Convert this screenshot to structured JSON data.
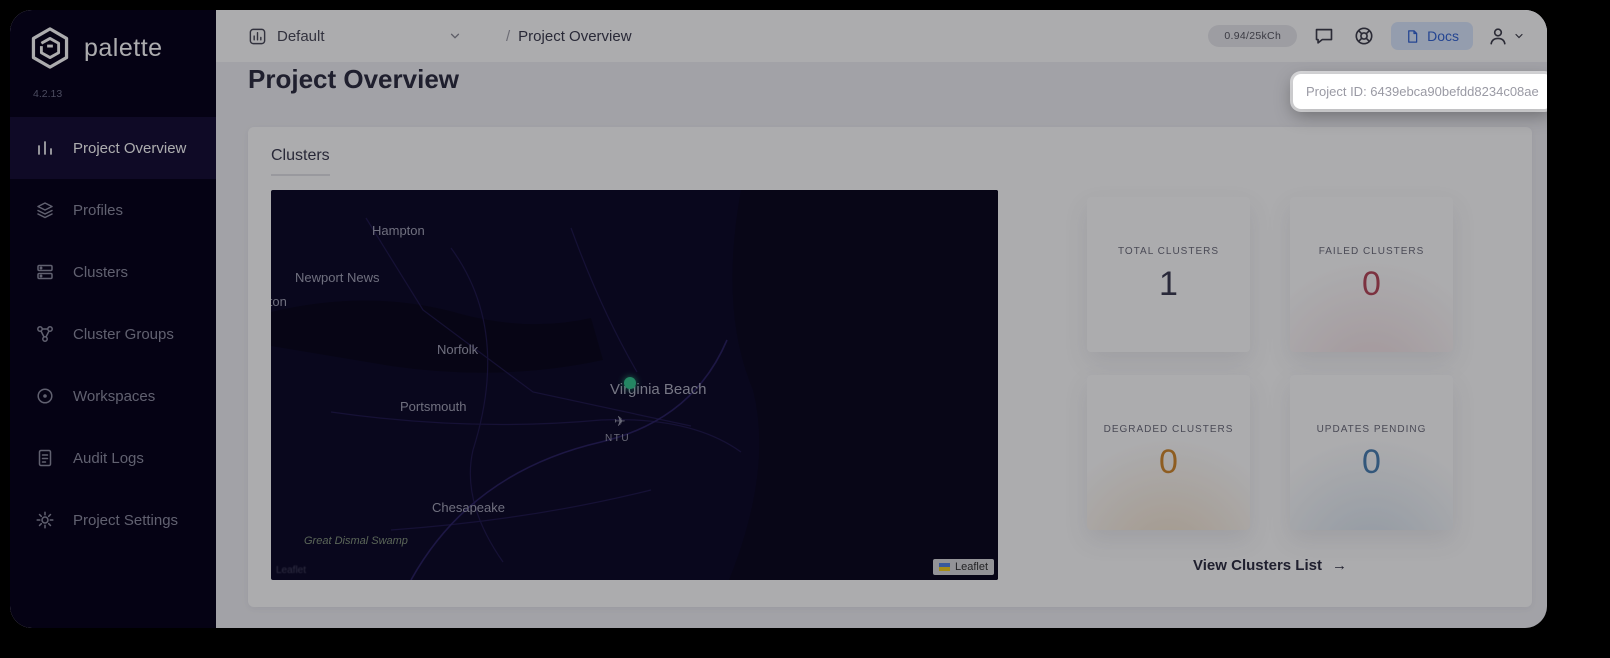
{
  "sidebar": {
    "brand": "palette",
    "version": "4.2.13",
    "items": [
      {
        "label": "Project Overview",
        "active": true
      },
      {
        "label": "Profiles",
        "active": false
      },
      {
        "label": "Clusters",
        "active": false
      },
      {
        "label": "Cluster Groups",
        "active": false
      },
      {
        "label": "Workspaces",
        "active": false
      },
      {
        "label": "Audit Logs",
        "active": false
      },
      {
        "label": "Project Settings",
        "active": false
      }
    ]
  },
  "topbar": {
    "scope_value": "Default",
    "breadcrumb_separator": "/",
    "breadcrumb_current": "Project Overview",
    "usage_badge": "0.94/25kCh",
    "docs_label": "Docs"
  },
  "page": {
    "title": "Project Overview",
    "project_id_tooltip": "Project ID: 6439ebca90befdd8234c08ae"
  },
  "clusters_card": {
    "title": "Clusters",
    "stats": [
      {
        "label": "TOTAL CLUSTERS",
        "value": "1",
        "color": "#3d3d52"
      },
      {
        "label": "FAILED CLUSTERS",
        "value": "0",
        "color": "#b8495c"
      },
      {
        "label": "DEGRADED CLUSTERS",
        "value": "0",
        "color": "#d28a2e"
      },
      {
        "label": "UPDATES PENDING",
        "value": "0",
        "color": "#4b80b4"
      }
    ],
    "view_link_label": "View Clusters List",
    "view_link_arrow": "→"
  },
  "map": {
    "labels": [
      {
        "text": "Hampton"
      },
      {
        "text": "Newport News"
      },
      {
        "text": "llton"
      },
      {
        "text": "Norfolk"
      },
      {
        "text": "Virginia Beach"
      },
      {
        "text": "Portsmouth"
      },
      {
        "text": "Chesapeake"
      },
      {
        "text": "Great Dismal Swamp"
      }
    ],
    "airport_code": "NTU",
    "plane_glyph": "✈",
    "attribution": "Leaflet",
    "attribution_faint": "Leaflet",
    "marker_color": "#35c78f"
  },
  "colors": {
    "accent_blue": "#3566d6",
    "sidebar_bg": "#07021a",
    "map_bg": "#0d0a28"
  }
}
